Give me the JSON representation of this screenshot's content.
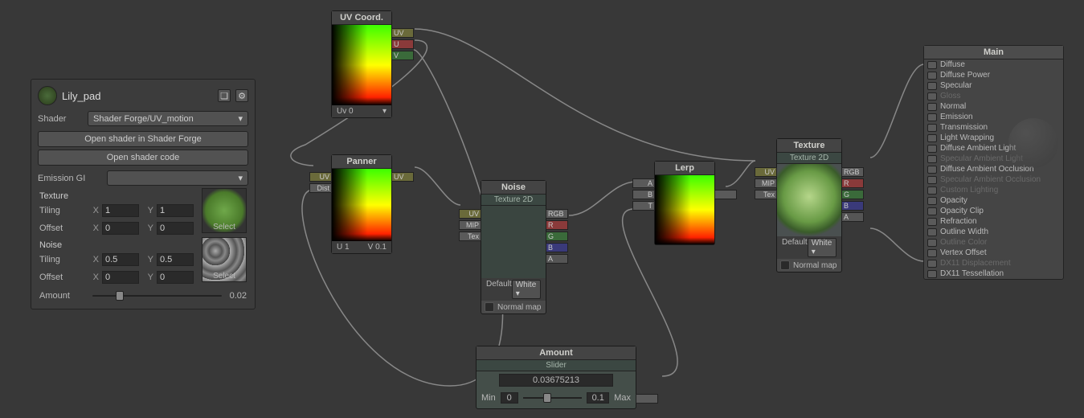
{
  "inspector": {
    "material": "Lily_pad",
    "shader_label": "Shader",
    "shader_value": "Shader Forge/UV_motion",
    "open_sf": "Open shader in Shader Forge",
    "open_code": "Open shader code",
    "emission_gi_label": "Emission GI",
    "texture_section": "Texture",
    "noise_section": "Noise",
    "tiling_label": "Tiling",
    "offset_label": "Offset",
    "select_label": "Select",
    "tex": {
      "tiling_x": "1",
      "tiling_y": "1",
      "offset_x": "0",
      "offset_y": "0"
    },
    "noise": {
      "tiling_x": "0.5",
      "tiling_y": "0.5",
      "offset_x": "0",
      "offset_y": "0"
    },
    "amount_label": "Amount",
    "amount_value": "0.02"
  },
  "nodes": {
    "uv_coord": {
      "title": "UV Coord.",
      "footer": "Uv 0",
      "outs": [
        "UV",
        "U",
        "V"
      ]
    },
    "panner": {
      "title": "Panner",
      "ins": [
        "UV",
        "Dist"
      ],
      "out": "UV",
      "u": "U 1",
      "v": "V 0.1"
    },
    "noise": {
      "title": "Noise",
      "sub": "Texture 2D",
      "ins": [
        "UV",
        "MIP",
        "Tex"
      ],
      "outs": [
        "RGB",
        "R",
        "G",
        "B",
        "A"
      ],
      "default_label": "Default",
      "default_value": "White",
      "normal": "Normal map"
    },
    "lerp": {
      "title": "Lerp",
      "ins": [
        "A",
        "B",
        "T"
      ]
    },
    "texture": {
      "title": "Texture",
      "sub": "Texture 2D",
      "ins": [
        "UV",
        "MIP",
        "Tex"
      ],
      "outs": [
        "RGB",
        "R",
        "G",
        "B",
        "A"
      ],
      "default_label": "Default",
      "default_value": "White",
      "normal": "Normal map"
    },
    "amount": {
      "title": "Amount",
      "sub": "Slider",
      "value": "0.03675213",
      "min_label": "Min",
      "min": "0",
      "max": "0.1",
      "max_label": "Max"
    }
  },
  "main": {
    "title": "Main",
    "rows": [
      {
        "label": "Diffuse",
        "dim": false
      },
      {
        "label": "Diffuse Power",
        "dim": false
      },
      {
        "label": "Specular",
        "dim": false
      },
      {
        "label": "Gloss",
        "dim": true
      },
      {
        "label": "Normal",
        "dim": false
      },
      {
        "label": "Emission",
        "dim": false
      },
      {
        "label": "Transmission",
        "dim": false
      },
      {
        "label": "Light Wrapping",
        "dim": false
      },
      {
        "label": "Diffuse Ambient Light",
        "dim": false
      },
      {
        "label": "Specular Ambient Light",
        "dim": true
      },
      {
        "label": "Diffuse Ambient Occlusion",
        "dim": false
      },
      {
        "label": "Specular Ambient Occlusion",
        "dim": true
      },
      {
        "label": "Custom Lighting",
        "dim": true
      },
      {
        "label": "Opacity",
        "dim": false
      },
      {
        "label": "Opacity Clip",
        "dim": false
      },
      {
        "label": "Refraction",
        "dim": false
      },
      {
        "label": "Outline Width",
        "dim": false
      },
      {
        "label": "Outline Color",
        "dim": true
      },
      {
        "label": "Vertex Offset",
        "dim": false
      },
      {
        "label": "DX11 Displacement",
        "dim": true
      },
      {
        "label": "DX11 Tessellation",
        "dim": false
      }
    ]
  }
}
